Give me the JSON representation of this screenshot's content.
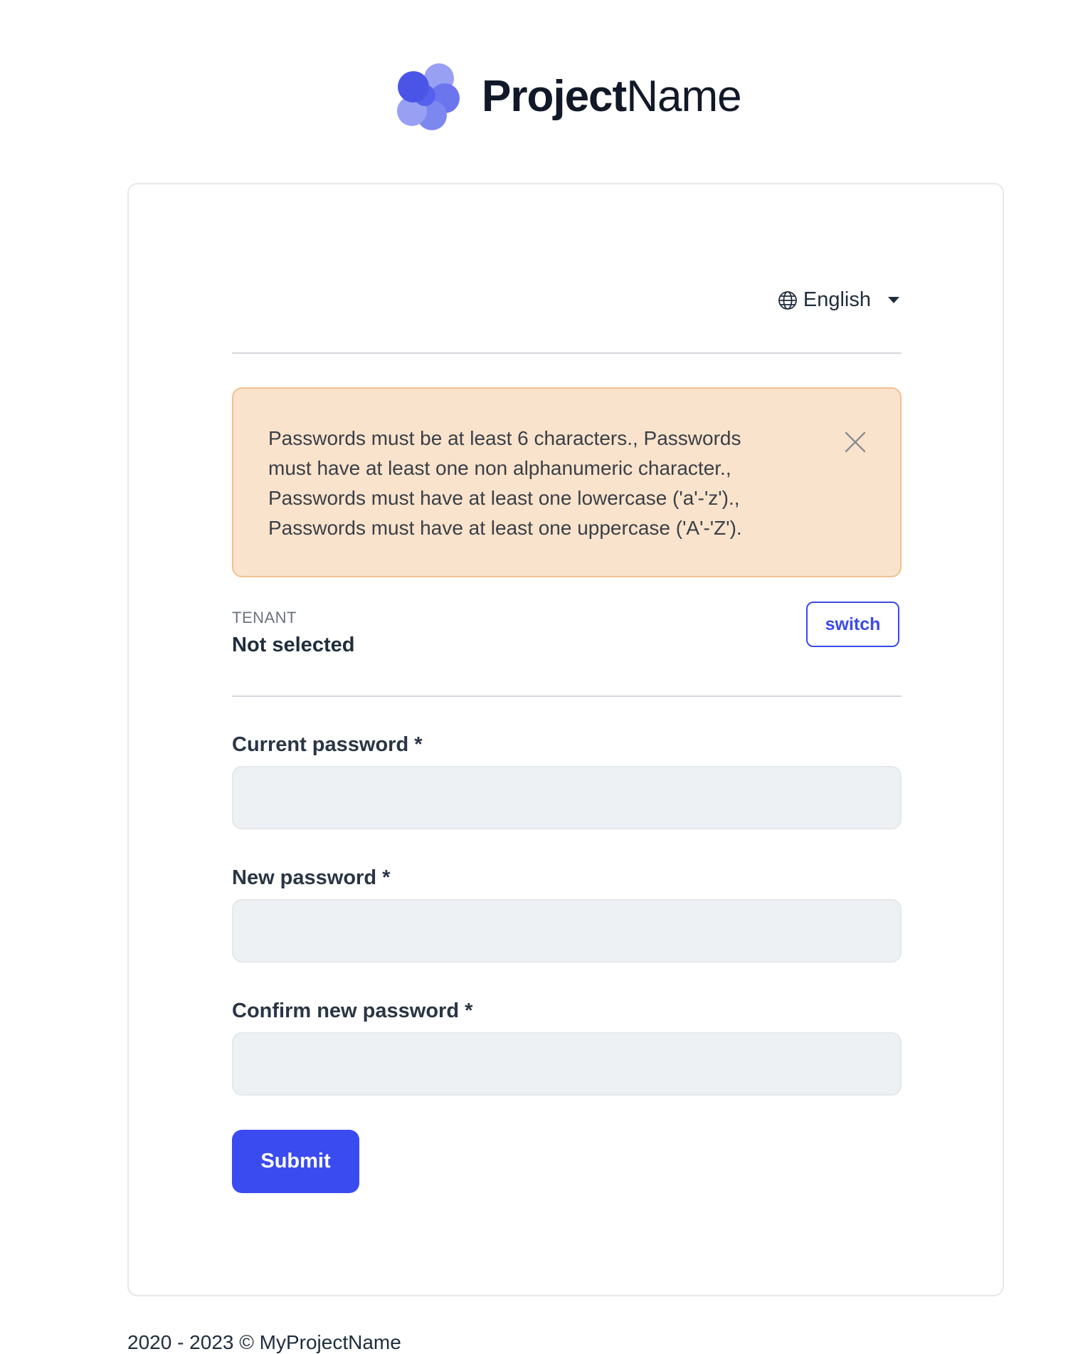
{
  "brand": {
    "name_bold": "Project",
    "name_light": "Name",
    "colors": {
      "dark": "#4a55e8",
      "mid": "#6b76ee",
      "light": "#98a0f4"
    }
  },
  "language": {
    "selected": "English",
    "icon": "globe-icon"
  },
  "alert": {
    "message": "Passwords must be at least 6 characters., Passwords must have at least one non alphanumeric character., Passwords must have at least one lowercase ('a'-'z')., Passwords must have at least one uppercase ('A'-'Z').",
    "close_icon": "close-icon"
  },
  "tenant": {
    "label": "TENANT",
    "value": "Not selected",
    "switch_label": "switch"
  },
  "form": {
    "current_password_label": "Current password *",
    "current_password_value": "",
    "new_password_label": "New password *",
    "new_password_value": "",
    "confirm_password_label": "Confirm new password *",
    "confirm_password_value": "",
    "submit_label": "Submit"
  },
  "footer": {
    "text": "2020 - 2023 © MyProjectName"
  },
  "colors": {
    "primary": "#3a4bf0",
    "alert_bg": "#f9e3cc",
    "alert_border": "#f2c08f",
    "input_bg": "#eef1f4"
  }
}
